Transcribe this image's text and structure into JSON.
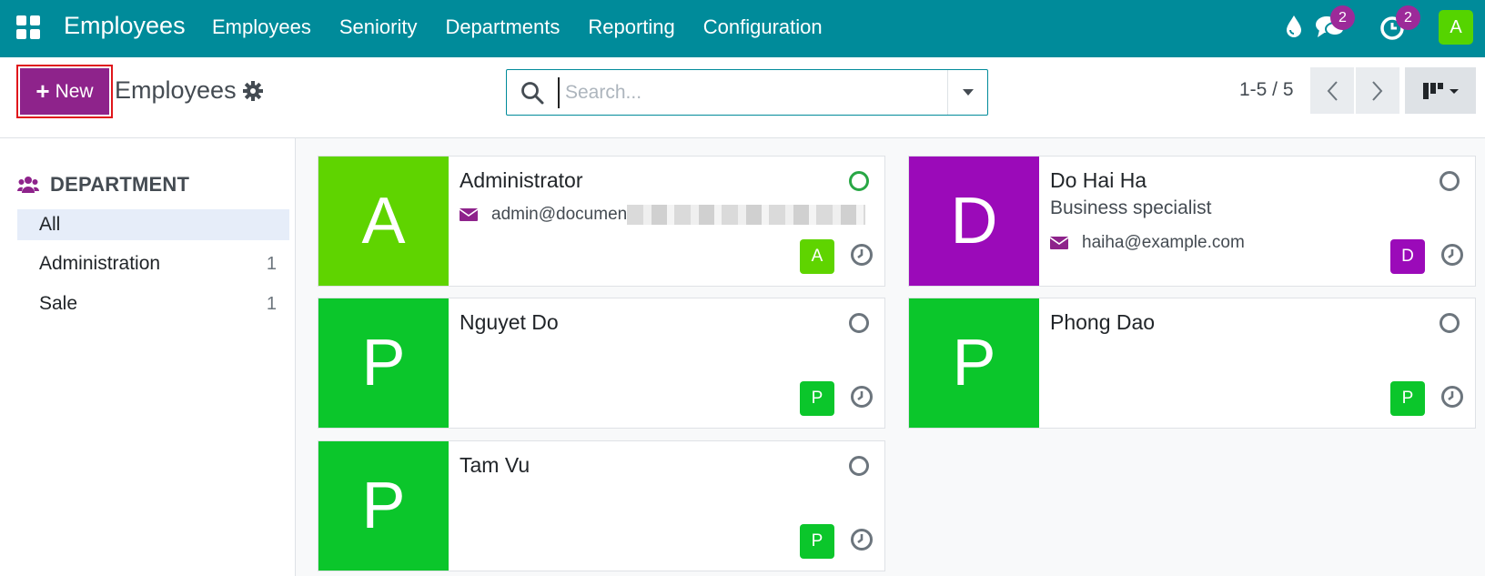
{
  "nav": {
    "app_name": "Employees",
    "menu": [
      "Employees",
      "Seniority",
      "Departments",
      "Reporting",
      "Configuration"
    ],
    "chat_count": "2",
    "activity_count": "2",
    "user_initial": "A"
  },
  "control": {
    "new_label": "New",
    "title": "Employees",
    "search_placeholder": "Search...",
    "pager": "1-5 / 5"
  },
  "sidebar": {
    "heading": "DEPARTMENT",
    "items": [
      {
        "label": "All",
        "count": ""
      },
      {
        "label": "Administration",
        "count": "1"
      },
      {
        "label": "Sale",
        "count": "1"
      }
    ]
  },
  "employees": [
    {
      "name": "Administrator",
      "initial": "A",
      "color": "#5fd400",
      "job": "",
      "email": "admin@documen",
      "email_redacted": true,
      "status": "online"
    },
    {
      "name": "Do Hai Ha",
      "initial": "D",
      "color": "#9b0ab9",
      "job": "Business specialist",
      "email": "haiha@example.com",
      "email_redacted": false,
      "status": "offline"
    },
    {
      "name": "Nguyet Do",
      "initial": "P",
      "color": "#0bc62b",
      "job": "",
      "email": "",
      "email_redacted": false,
      "status": "offline"
    },
    {
      "name": "Phong Dao",
      "initial": "P",
      "color": "#0bc62b",
      "job": "",
      "email": "",
      "email_redacted": false,
      "status": "offline"
    },
    {
      "name": "Tam Vu",
      "initial": "P",
      "color": "#0bc62b",
      "job": "",
      "email": "",
      "email_redacted": false,
      "status": "offline"
    }
  ],
  "colors": {
    "topbar": "#008b9a",
    "primary": "#8e238b",
    "badge": "#9c2a99"
  }
}
